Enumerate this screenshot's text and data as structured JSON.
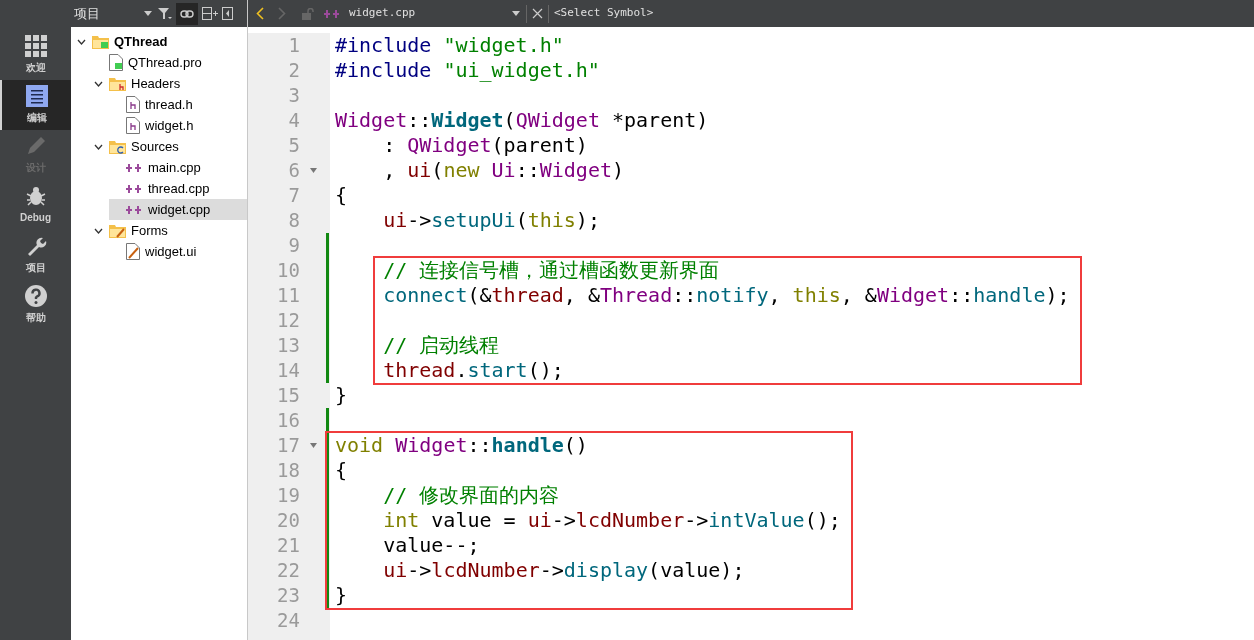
{
  "mode_bar": [
    {
      "kind": "grid",
      "label": "欢迎",
      "selected": false,
      "disabled": false
    },
    {
      "kind": "edit",
      "label": "编辑",
      "selected": true,
      "disabled": false
    },
    {
      "kind": "pencil",
      "label": "设计",
      "selected": false,
      "disabled": true
    },
    {
      "kind": "bug",
      "label": "Debug",
      "selected": false,
      "disabled": false
    },
    {
      "kind": "wrench",
      "label": "项目",
      "selected": false,
      "disabled": false
    },
    {
      "kind": "help",
      "label": "帮助",
      "selected": false,
      "disabled": false
    }
  ],
  "project_panel": {
    "title": "项目",
    "tree": [
      {
        "kind": "project",
        "label": "QThread",
        "expanded": true,
        "selected": false,
        "children": [
          {
            "kind": "pro",
            "label": "QThread.pro",
            "selected": false
          },
          {
            "kind": "headers",
            "label": "Headers",
            "expanded": true,
            "selected": false,
            "children": [
              {
                "kind": "header",
                "label": "thread.h",
                "selected": false
              },
              {
                "kind": "header",
                "label": "widget.h",
                "selected": false
              }
            ]
          },
          {
            "kind": "sources",
            "label": "Sources",
            "expanded": true,
            "selected": false,
            "children": [
              {
                "kind": "source",
                "label": "main.cpp",
                "selected": false
              },
              {
                "kind": "source",
                "label": "thread.cpp",
                "selected": false
              },
              {
                "kind": "source",
                "label": "widget.cpp",
                "selected": true
              }
            ]
          },
          {
            "kind": "forms",
            "label": "Forms",
            "expanded": true,
            "selected": false,
            "children": [
              {
                "kind": "form",
                "label": "widget.ui",
                "selected": false
              }
            ]
          }
        ]
      }
    ]
  },
  "editor_toolbar": {
    "file": "widget.cpp",
    "symbol": "<Select Symbol>"
  },
  "code": {
    "blocks": [
      {
        "boxed": false,
        "lines": [
          {
            "number": "1",
            "fold": false,
            "modified": false,
            "indented": false,
            "tokens": [
              {
                "kind": "preproc",
                "text": "#include "
              },
              {
                "kind": "string",
                "text": "\"widget.h\""
              }
            ]
          },
          {
            "number": "2",
            "fold": false,
            "modified": false,
            "indented": false,
            "tokens": [
              {
                "kind": "preproc",
                "text": "#include "
              },
              {
                "kind": "string",
                "text": "\"ui_widget.h\""
              }
            ]
          },
          {
            "number": "3",
            "fold": false,
            "modified": false
          },
          {
            "number": "4",
            "fold": false,
            "modified": false,
            "indented": false,
            "tokens": [
              {
                "kind": "type",
                "text": "Widget"
              },
              {
                "kind": "plain",
                "text": "::"
              },
              {
                "kind": "def",
                "text": "Widget"
              },
              {
                "kind": "plain",
                "text": "("
              },
              {
                "kind": "type",
                "text": "QWidget"
              },
              {
                "kind": "plain",
                "text": " *parent)"
              }
            ]
          },
          {
            "number": "5",
            "fold": false,
            "modified": false,
            "indented": true,
            "tokens": [
              {
                "kind": "plain",
                "text": ": "
              },
              {
                "kind": "type",
                "text": "QWidget"
              },
              {
                "kind": "plain",
                "text": "(parent)"
              }
            ]
          },
          {
            "number": "6",
            "fold": true,
            "modified": false,
            "indented": true,
            "tokens": [
              {
                "kind": "plain",
                "text": ", "
              },
              {
                "kind": "field",
                "text": "ui"
              },
              {
                "kind": "plain",
                "text": "("
              },
              {
                "kind": "keyword",
                "text": "new"
              },
              {
                "kind": "type",
                "text": " Ui"
              },
              {
                "kind": "plain",
                "text": "::"
              },
              {
                "kind": "type",
                "text": "Widget"
              },
              {
                "kind": "plain",
                "text": ")"
              }
            ]
          },
          {
            "number": "7",
            "fold": false,
            "modified": false,
            "indented": false,
            "tokens": [
              {
                "kind": "plain",
                "text": "{"
              }
            ]
          },
          {
            "number": "8",
            "fold": false,
            "modified": false,
            "indented": true,
            "tokens": [
              {
                "kind": "field",
                "text": "ui"
              },
              {
                "kind": "plain",
                "text": "->"
              },
              {
                "kind": "func",
                "text": "setupUi"
              },
              {
                "kind": "plain",
                "text": "("
              },
              {
                "kind": "keyword",
                "text": "this"
              },
              {
                "kind": "plain",
                "text": ");"
              }
            ]
          },
          {
            "number": "9",
            "fold": false,
            "modified": true
          }
        ]
      },
      {
        "boxed": true,
        "lines": [
          {
            "number": "10",
            "fold": false,
            "modified": true,
            "indented": true,
            "tokens": [
              {
                "kind": "comment",
                "text": "// 连接信号槽，通过槽函数更新界面"
              }
            ]
          },
          {
            "number": "11",
            "fold": false,
            "modified": true,
            "indented": true,
            "tokens": [
              {
                "kind": "func",
                "text": "connect"
              },
              {
                "kind": "plain",
                "text": "(&"
              },
              {
                "kind": "field",
                "text": "thread"
              },
              {
                "kind": "plain",
                "text": ", &"
              },
              {
                "kind": "type",
                "text": "Thread"
              },
              {
                "kind": "plain",
                "text": "::"
              },
              {
                "kind": "func",
                "text": "notify"
              },
              {
                "kind": "plain",
                "text": ", "
              },
              {
                "kind": "keyword",
                "text": "this"
              },
              {
                "kind": "plain",
                "text": ", &"
              },
              {
                "kind": "type",
                "text": "Widget"
              },
              {
                "kind": "plain",
                "text": "::"
              },
              {
                "kind": "func",
                "text": "handle"
              },
              {
                "kind": "plain",
                "text": ");"
              }
            ]
          },
          {
            "number": "12",
            "fold": false,
            "modified": true
          },
          {
            "number": "13",
            "fold": false,
            "modified": true,
            "indented": true,
            "tokens": [
              {
                "kind": "comment",
                "text": "// 启动线程"
              }
            ]
          },
          {
            "number": "14",
            "fold": false,
            "modified": true,
            "indented": true,
            "tokens": [
              {
                "kind": "field",
                "text": "thread"
              },
              {
                "kind": "plain",
                "text": "."
              },
              {
                "kind": "func",
                "text": "start"
              },
              {
                "kind": "plain",
                "text": "();"
              }
            ]
          }
        ]
      },
      {
        "boxed": false,
        "lines": [
          {
            "number": "15",
            "fold": false,
            "modified": false,
            "indented": false,
            "tokens": [
              {
                "kind": "plain",
                "text": "}"
              }
            ]
          },
          {
            "number": "16",
            "fold": false,
            "modified": true
          }
        ]
      },
      {
        "boxed": true,
        "lines": [
          {
            "number": "17",
            "fold": true,
            "modified": true,
            "indented": false,
            "tokens": [
              {
                "kind": "keyword",
                "text": "void"
              },
              {
                "kind": "type",
                "text": " Widget"
              },
              {
                "kind": "plain",
                "text": "::"
              },
              {
                "kind": "def",
                "text": "handle"
              },
              {
                "kind": "plain",
                "text": "()"
              }
            ]
          },
          {
            "number": "18",
            "fold": false,
            "modified": true,
            "indented": false,
            "tokens": [
              {
                "kind": "plain",
                "text": "{"
              }
            ]
          },
          {
            "number": "19",
            "fold": false,
            "modified": true,
            "indented": true,
            "tokens": [
              {
                "kind": "comment",
                "text": "// 修改界面的内容"
              }
            ]
          },
          {
            "number": "20",
            "fold": false,
            "modified": true,
            "indented": true,
            "tokens": [
              {
                "kind": "keyword",
                "text": "int"
              },
              {
                "kind": "plain",
                "text": " value = "
              },
              {
                "kind": "field",
                "text": "ui"
              },
              {
                "kind": "plain",
                "text": "->"
              },
              {
                "kind": "field",
                "text": "lcdNumber"
              },
              {
                "kind": "plain",
                "text": "->"
              },
              {
                "kind": "func",
                "text": "intValue"
              },
              {
                "kind": "plain",
                "text": "();"
              }
            ]
          },
          {
            "number": "21",
            "fold": false,
            "modified": true,
            "indented": true,
            "tokens": [
              {
                "kind": "plain",
                "text": "value--;"
              }
            ]
          },
          {
            "number": "22",
            "fold": false,
            "modified": true,
            "indented": true,
            "tokens": [
              {
                "kind": "field",
                "text": "ui"
              },
              {
                "kind": "plain",
                "text": "->"
              },
              {
                "kind": "field",
                "text": "lcdNumber"
              },
              {
                "kind": "plain",
                "text": "->"
              },
              {
                "kind": "func",
                "text": "display"
              },
              {
                "kind": "plain",
                "text": "(value);"
              }
            ]
          },
          {
            "number": "23",
            "fold": false,
            "modified": true,
            "indented": false,
            "tokens": [
              {
                "kind": "plain",
                "text": "}"
              }
            ]
          }
        ]
      },
      {
        "boxed": false,
        "lines": [
          {
            "number": "24",
            "fold": false,
            "modified": false
          }
        ]
      }
    ]
  }
}
